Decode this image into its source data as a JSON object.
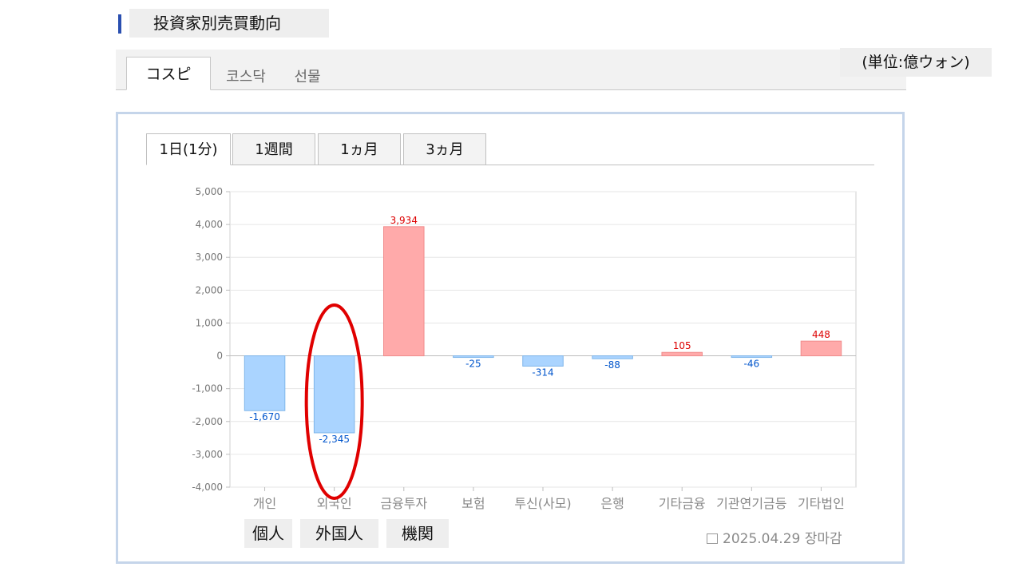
{
  "header": {
    "title": "投資家別売買動向"
  },
  "market_tabs": [
    {
      "label": "コスピ",
      "active": true
    },
    {
      "label": "코스닥",
      "active": false
    },
    {
      "label": "선물",
      "active": false
    }
  ],
  "unit_label": "(単位:億ウォン)",
  "period_tabs": [
    {
      "label": "1日(1分)",
      "active": true
    },
    {
      "label": "1週間",
      "active": false
    },
    {
      "label": "1ヵ月",
      "active": false
    },
    {
      "label": "3ヵ月",
      "active": false
    }
  ],
  "chart_data": {
    "type": "bar",
    "categories": [
      "개인",
      "외국인",
      "금융투자",
      "보험",
      "투신(사모)",
      "은행",
      "기타금융",
      "기관연기금등",
      "기타법인"
    ],
    "values": [
      -1670,
      -2345,
      3934,
      -25,
      -314,
      -88,
      105,
      -46,
      448
    ],
    "value_labels": [
      "-1,670",
      "-2,345",
      "3,934",
      "-25",
      "-314",
      "-88",
      "105",
      "-46",
      "448"
    ],
    "ylim": [
      -4000,
      5000
    ],
    "yticks": [
      5000,
      4000,
      3000,
      2000,
      1000,
      0,
      -1000,
      -2000,
      -3000,
      -4000
    ],
    "ytick_labels": [
      "5,000",
      "4,000",
      "3,000",
      "2,000",
      "1,000",
      "0",
      "-1,000",
      "-2,000",
      "-3,000",
      "-4,000"
    ],
    "grid": true,
    "colors": {
      "positive": "#ffaaaa",
      "negative": "#aad4ff",
      "positive_label": "#dd0000",
      "negative_label": "#0055cc"
    },
    "highlighted_category": "외국인"
  },
  "jp_labels": [
    "個人",
    "外国人",
    "機関"
  ],
  "date_label": "2025.04.29 장마감",
  "highlight_color": "#e00000"
}
